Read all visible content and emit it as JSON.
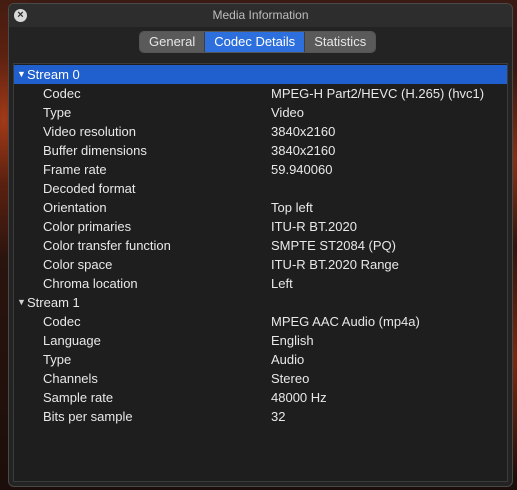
{
  "window": {
    "title": "Media Information",
    "close_glyph": "×",
    "close_icon": "close-icon"
  },
  "tabs": [
    {
      "label": "General"
    },
    {
      "label": "Codec Details",
      "selected": true
    },
    {
      "label": "Statistics"
    }
  ],
  "colors": {
    "accent": "#2d6fdd",
    "selection": "#1f5fce"
  },
  "disclosure_glyph": "▼",
  "streams": [
    {
      "label": "Stream 0",
      "expanded": true,
      "selected": true,
      "props": [
        {
          "name": "Codec",
          "value": "MPEG-H Part2/HEVC (H.265) (hvc1)"
        },
        {
          "name": "Type",
          "value": "Video"
        },
        {
          "name": "Video resolution",
          "value": "3840x2160"
        },
        {
          "name": "Buffer dimensions",
          "value": "3840x2160"
        },
        {
          "name": "Frame rate",
          "value": "59.940060"
        },
        {
          "name": "Decoded format",
          "value": ""
        },
        {
          "name": "Orientation",
          "value": "Top left"
        },
        {
          "name": "Color primaries",
          "value": "ITU-R BT.2020"
        },
        {
          "name": "Color transfer function",
          "value": "SMPTE ST2084 (PQ)"
        },
        {
          "name": "Color space",
          "value": "ITU-R BT.2020 Range"
        },
        {
          "name": "Chroma location",
          "value": "Left"
        }
      ]
    },
    {
      "label": "Stream 1",
      "expanded": true,
      "selected": false,
      "props": [
        {
          "name": "Codec",
          "value": "MPEG AAC Audio (mp4a)"
        },
        {
          "name": "Language",
          "value": "English"
        },
        {
          "name": "Type",
          "value": "Audio"
        },
        {
          "name": "Channels",
          "value": "Stereo"
        },
        {
          "name": "Sample rate",
          "value": "48000 Hz"
        },
        {
          "name": "Bits per sample",
          "value": "32"
        }
      ]
    }
  ]
}
